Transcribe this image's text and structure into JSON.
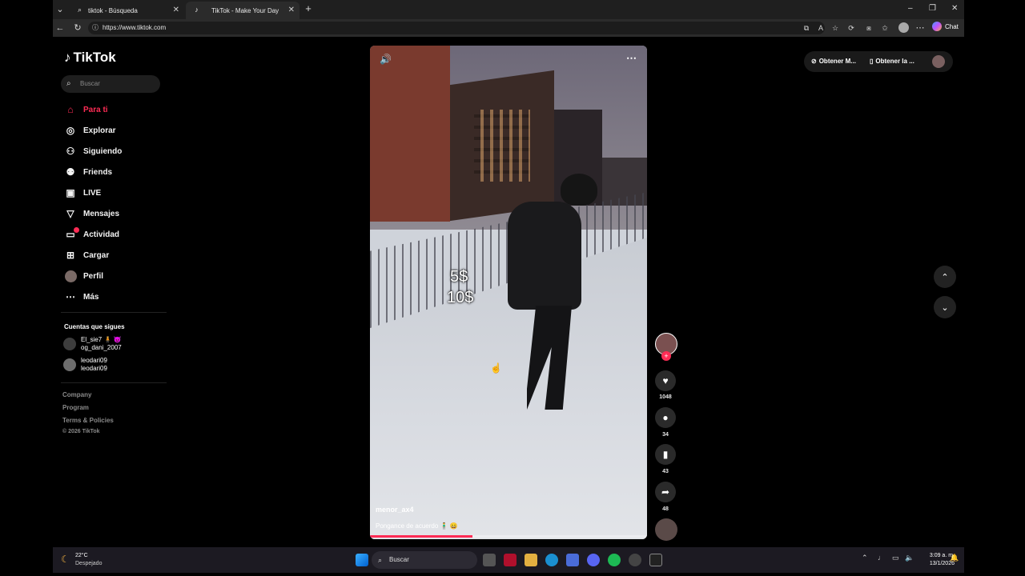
{
  "browser": {
    "tabs": [
      {
        "title": "tiktok - Búsqueda",
        "icon": "search-icon"
      },
      {
        "title": "TikTok - Make Your Day",
        "icon": "tiktok-icon"
      }
    ],
    "url": "https://www.tiktok.com",
    "chat_label": "Chat"
  },
  "sidebar": {
    "logo_text": "TikTok",
    "search_placeholder": "Buscar",
    "nav": [
      {
        "label": "Para ti",
        "icon": "home-icon"
      },
      {
        "label": "Explorar",
        "icon": "compass-icon"
      },
      {
        "label": "Siguiendo",
        "icon": "user-follow-icon"
      },
      {
        "label": "Friends",
        "icon": "friends-icon"
      },
      {
        "label": "LIVE",
        "icon": "live-icon"
      },
      {
        "label": "Mensajes",
        "icon": "send-icon"
      },
      {
        "label": "Actividad",
        "icon": "activity-icon"
      },
      {
        "label": "Cargar",
        "icon": "upload-icon"
      },
      {
        "label": "Perfil",
        "icon": "profile-avatar"
      },
      {
        "label": "Más",
        "icon": "more-icon"
      }
    ],
    "following_title": "Cuentas que sigues",
    "following": [
      {
        "name": "El_sie7 🧍 👿",
        "handle": "og_dani_2007"
      },
      {
        "name": "leodari09",
        "handle": "leodari09"
      }
    ],
    "footer": [
      "Company",
      "Program",
      "Terms & Policies",
      "© 2026 TikTok"
    ]
  },
  "video": {
    "overlay_text": [
      "5$",
      "10$"
    ],
    "username": "menor_ax4",
    "caption": "Pongance de acuerdo 🧍‍♂️ 😄",
    "progress": 0.37
  },
  "actions": {
    "likes": "1048",
    "comments": "34",
    "saves": "43",
    "shares": "48"
  },
  "top_right": {
    "btn1": "Obtener M...",
    "btn2": "Obtener la ..."
  },
  "taskbar": {
    "weather_temp": "22°C",
    "weather_desc": "Despejado",
    "search_placeholder": "Buscar",
    "time": "3:09 a. m.",
    "date": "13/1/2026"
  },
  "colors": {
    "accent": "#fe2c55",
    "bg": "#000000"
  }
}
